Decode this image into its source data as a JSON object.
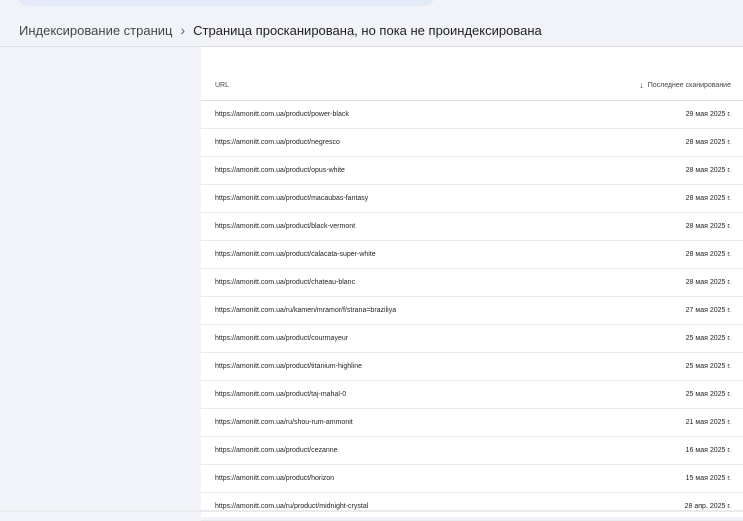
{
  "breadcrumb": {
    "parent": "Индексирование страниц",
    "separator": "›",
    "current": "Страница просканирована, но пока не проиндексирована"
  },
  "table": {
    "col_url": "URL",
    "col_date": "Последнее сканирование",
    "sort_icon": "arrow-down-icon",
    "rows": [
      {
        "url": "https://amonitt.com.ua/product/power-black",
        "date": "29 мая 2025 г."
      },
      {
        "url": "https://amonitt.com.ua/product/negresco",
        "date": "28 мая 2025 г."
      },
      {
        "url": "https://amonitt.com.ua/product/opus-white",
        "date": "28 мая 2025 г."
      },
      {
        "url": "https://amonitt.com.ua/product/macaubas-fantasy",
        "date": "28 мая 2025 г."
      },
      {
        "url": "https://amonitt.com.ua/product/black-vermont",
        "date": "28 мая 2025 г."
      },
      {
        "url": "https://amonitt.com.ua/product/calacata-super-white",
        "date": "28 мая 2025 г."
      },
      {
        "url": "https://amonitt.com.ua/product/chateau-blanc",
        "date": "28 мая 2025 г."
      },
      {
        "url": "https://amonitt.com.ua/ru/kamen/mramor/f/strana=braziliya",
        "date": "27 мая 2025 г."
      },
      {
        "url": "https://amonitt.com.ua/product/courmayeur",
        "date": "25 мая 2025 г."
      },
      {
        "url": "https://amonitt.com.ua/product/titanium-highline",
        "date": "25 мая 2025 г."
      },
      {
        "url": "https://amonitt.com.ua/product/taj-mahal-0",
        "date": "25 мая 2025 г."
      },
      {
        "url": "https://amonitt.com.ua/ru/shou-rum-ammonit",
        "date": "21 мая 2025 г."
      },
      {
        "url": "https://amonitt.com.ua/product/cezanne",
        "date": "16 мая 2025 г."
      },
      {
        "url": "https://amonitt.com.ua/product/horizon",
        "date": "15 мая 2025 г."
      },
      {
        "url": "https://amonitt.com.ua/ru/product/midnight-crystal",
        "date": "28 апр. 2025 г."
      }
    ]
  }
}
